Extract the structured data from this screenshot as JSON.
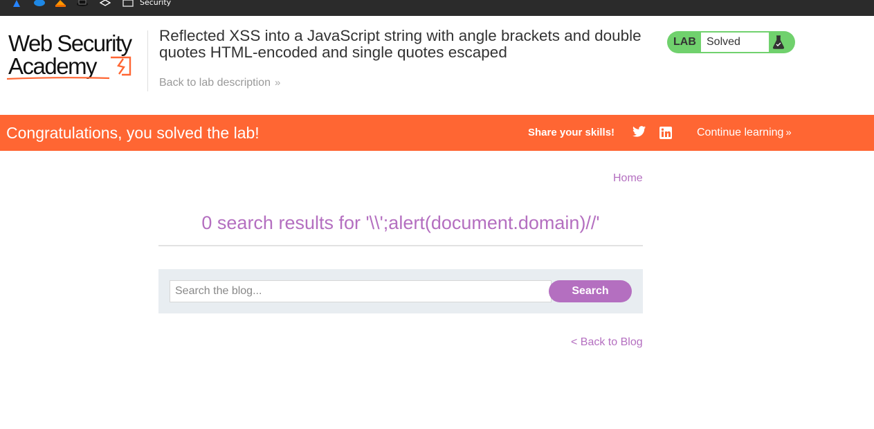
{
  "bookmarks": {
    "icons": [
      "atlassian-icon",
      "cloud-icon",
      "bookmark-orange-icon",
      "hat-icon",
      "layers-icon",
      "folder-icon"
    ],
    "label": "Security"
  },
  "header": {
    "logo_line1": "Web Security",
    "logo_line2": "Academy",
    "lab_title": "Reflected XSS into a JavaScript string with angle brackets and double quotes HTML-encoded and single quotes escaped",
    "back_link": "Back to lab description",
    "lab_badge": "LAB",
    "lab_status": "Solved"
  },
  "banner": {
    "message": "Congratulations, you solved the lab!",
    "share": "Share your skills!",
    "continue": "Continue learning"
  },
  "content": {
    "home": "Home",
    "results_heading": "0 search results for '\\\\';alert(document.domain)//'",
    "search_placeholder": "Search the blog...",
    "search_button": "Search",
    "back_to_blog": "< Back to Blog"
  },
  "colors": {
    "accent": "#b46fc0",
    "banner": "#ff6633",
    "status_green": "#70d16d",
    "search_panel": "#e8edf1"
  }
}
